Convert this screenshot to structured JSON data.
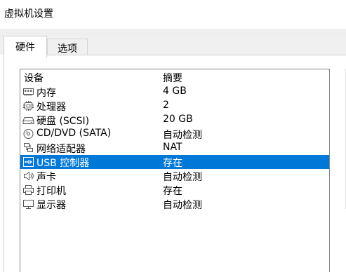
{
  "window": {
    "title": "虚拟机设置"
  },
  "tabs": [
    {
      "label": "硬件",
      "active": true
    },
    {
      "label": "选项",
      "active": false
    }
  ],
  "device_list": {
    "columns": {
      "device": "设备",
      "summary": "摘要"
    },
    "selected_index": 5,
    "selection_color": "#0078d7",
    "rows": [
      {
        "name": "内存",
        "summary": "4 GB",
        "icon": "memory-icon"
      },
      {
        "name": "处理器",
        "summary": "2",
        "icon": "processor-icon"
      },
      {
        "name": "硬盘 (SCSI)",
        "summary": "20 GB",
        "icon": "hard-disk-icon"
      },
      {
        "name": "CD/DVD (SATA)",
        "summary": "自动检测",
        "icon": "cd-dvd-icon"
      },
      {
        "name": "网络适配器",
        "summary": "NAT",
        "icon": "network-adapter-icon"
      },
      {
        "name": "USB 控制器",
        "summary": "存在",
        "icon": "usb-icon"
      },
      {
        "name": "声卡",
        "summary": "自动检测",
        "icon": "speaker-icon"
      },
      {
        "name": "打印机",
        "summary": "存在",
        "icon": "printer-icon"
      },
      {
        "name": "显示器",
        "summary": "自动检测",
        "icon": "monitor-icon"
      }
    ]
  }
}
